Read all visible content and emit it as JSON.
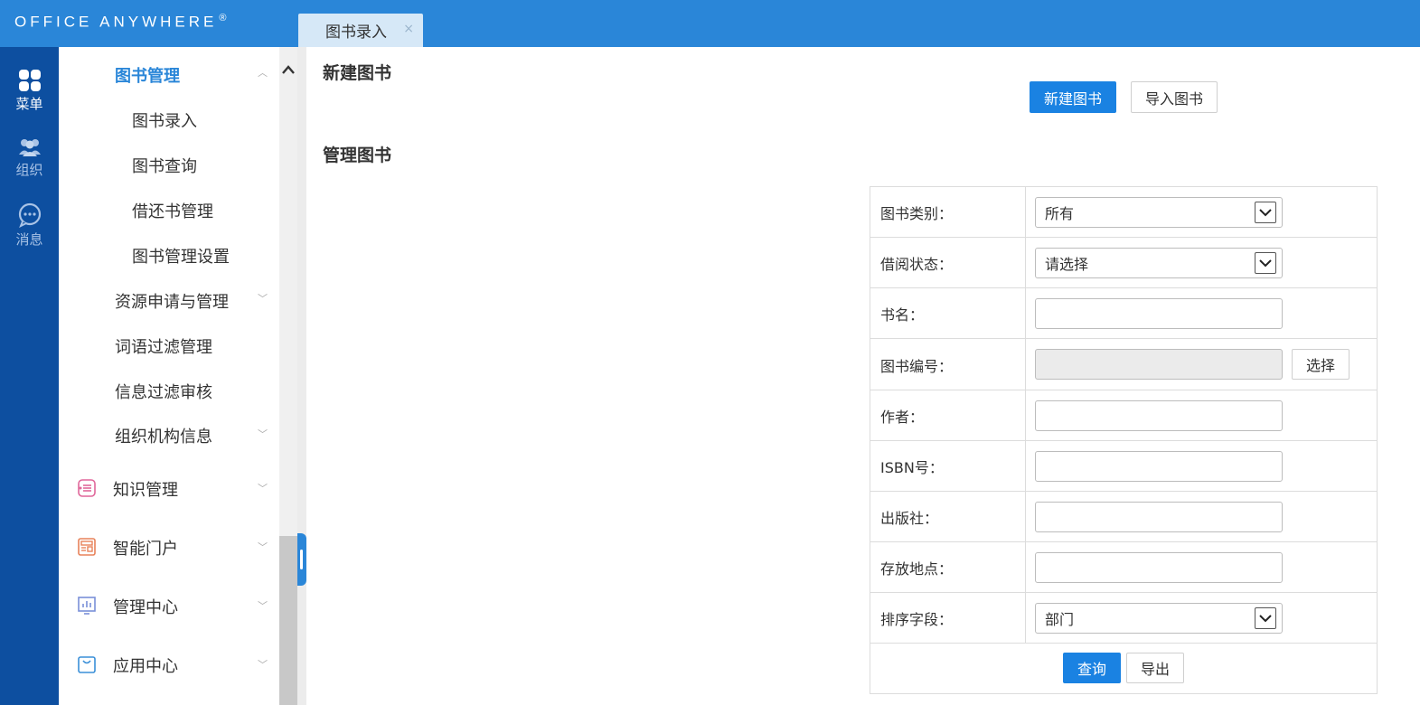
{
  "app": {
    "brand": "Office Anywhere",
    "registered_mark": "®"
  },
  "tabs": [
    {
      "label": "图书录入",
      "close_glyph": "×"
    }
  ],
  "rail": {
    "items": [
      {
        "label": "菜单",
        "icon": "grid-icon",
        "active": true
      },
      {
        "label": "组织",
        "icon": "people-icon",
        "active": false
      },
      {
        "label": "消息",
        "icon": "chat-icon",
        "active": false
      }
    ]
  },
  "menu": {
    "book_management": "图书管理",
    "book_sub": [
      "图书录入",
      "图书查询",
      "借还书管理",
      "图书管理设置"
    ],
    "resource": "资源申请与管理",
    "word_filter": "词语过滤管理",
    "info_filter": "信息过滤审核",
    "org_info": "组织机构信息",
    "sections": [
      {
        "label": "知识管理",
        "icon": "knowledge-icon",
        "color": "#e0679a"
      },
      {
        "label": "智能门户",
        "icon": "portal-icon",
        "color": "#e8825a"
      },
      {
        "label": "管理中心",
        "icon": "chart-icon",
        "color": "#7a8fd8"
      },
      {
        "label": "应用中心",
        "icon": "bag-icon",
        "color": "#3a8fd8"
      }
    ]
  },
  "main": {
    "new_book_title": "新建图书",
    "new_book_button": "新建图书",
    "import_button": "导入图书",
    "manage_title": "管理图书",
    "form": {
      "category_label": "图书类别：",
      "category_value": "所有",
      "borrow_label": "借阅状态：",
      "borrow_value": "请选择",
      "name_label": "书名：",
      "number_label": "图书编号：",
      "select_button": "选择",
      "author_label": "作者：",
      "isbn_label": "ISBN号：",
      "publisher_label": "出版社：",
      "location_label": "存放地点：",
      "sort_label": "排序字段：",
      "sort_value": "部门",
      "query_button": "查询",
      "export_button": "导出"
    }
  },
  "colors": {
    "topbar": "#2a86d8",
    "rail": "#0d4fa0",
    "accent": "#1a82e2"
  }
}
